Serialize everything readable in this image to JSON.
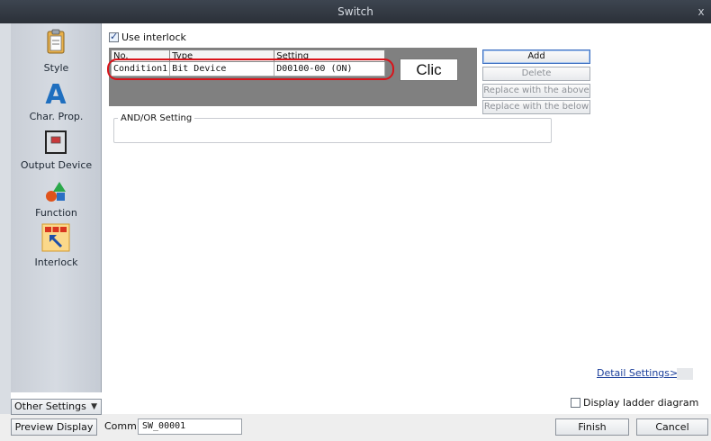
{
  "window": {
    "title": "Switch",
    "close": "x"
  },
  "sidebar": {
    "items": [
      {
        "label": "Style",
        "icon": "clipboard-icon"
      },
      {
        "label": "Char. Prop.",
        "icon": "letter-a-icon"
      },
      {
        "label": "Output Device",
        "icon": "output-device-icon"
      },
      {
        "label": "Function",
        "icon": "shapes-icon"
      },
      {
        "label": "Interlock",
        "icon": "interlock-icon"
      }
    ],
    "other_settings": "Other Settings"
  },
  "interlock": {
    "use_label": "Use interlock",
    "use_checked": true,
    "columns": [
      "No.",
      "Type",
      "Setting"
    ],
    "rows": [
      {
        "no": "Condition1",
        "type": "Bit Device",
        "setting": "D00100-00 (ON)"
      }
    ],
    "annotation": "Clic"
  },
  "buttons": {
    "add": "Add",
    "delete": "Delete",
    "replace_above": "Replace with the above",
    "replace_below": "Replace with the below"
  },
  "andor": {
    "label": "AND/OR Setting"
  },
  "detail_link": "Detail Settings>>",
  "ladder": {
    "label": "Display ladder diagram",
    "checked": false
  },
  "footer": {
    "preview": "Preview Display",
    "comm_label": "Comm",
    "comm_value": "SW_00001",
    "finish": "Finish",
    "cancel": "Cancel"
  },
  "colors": {
    "title_bar": "#2b3038",
    "highlight": "#d9131a",
    "link": "#1a3e9a"
  }
}
